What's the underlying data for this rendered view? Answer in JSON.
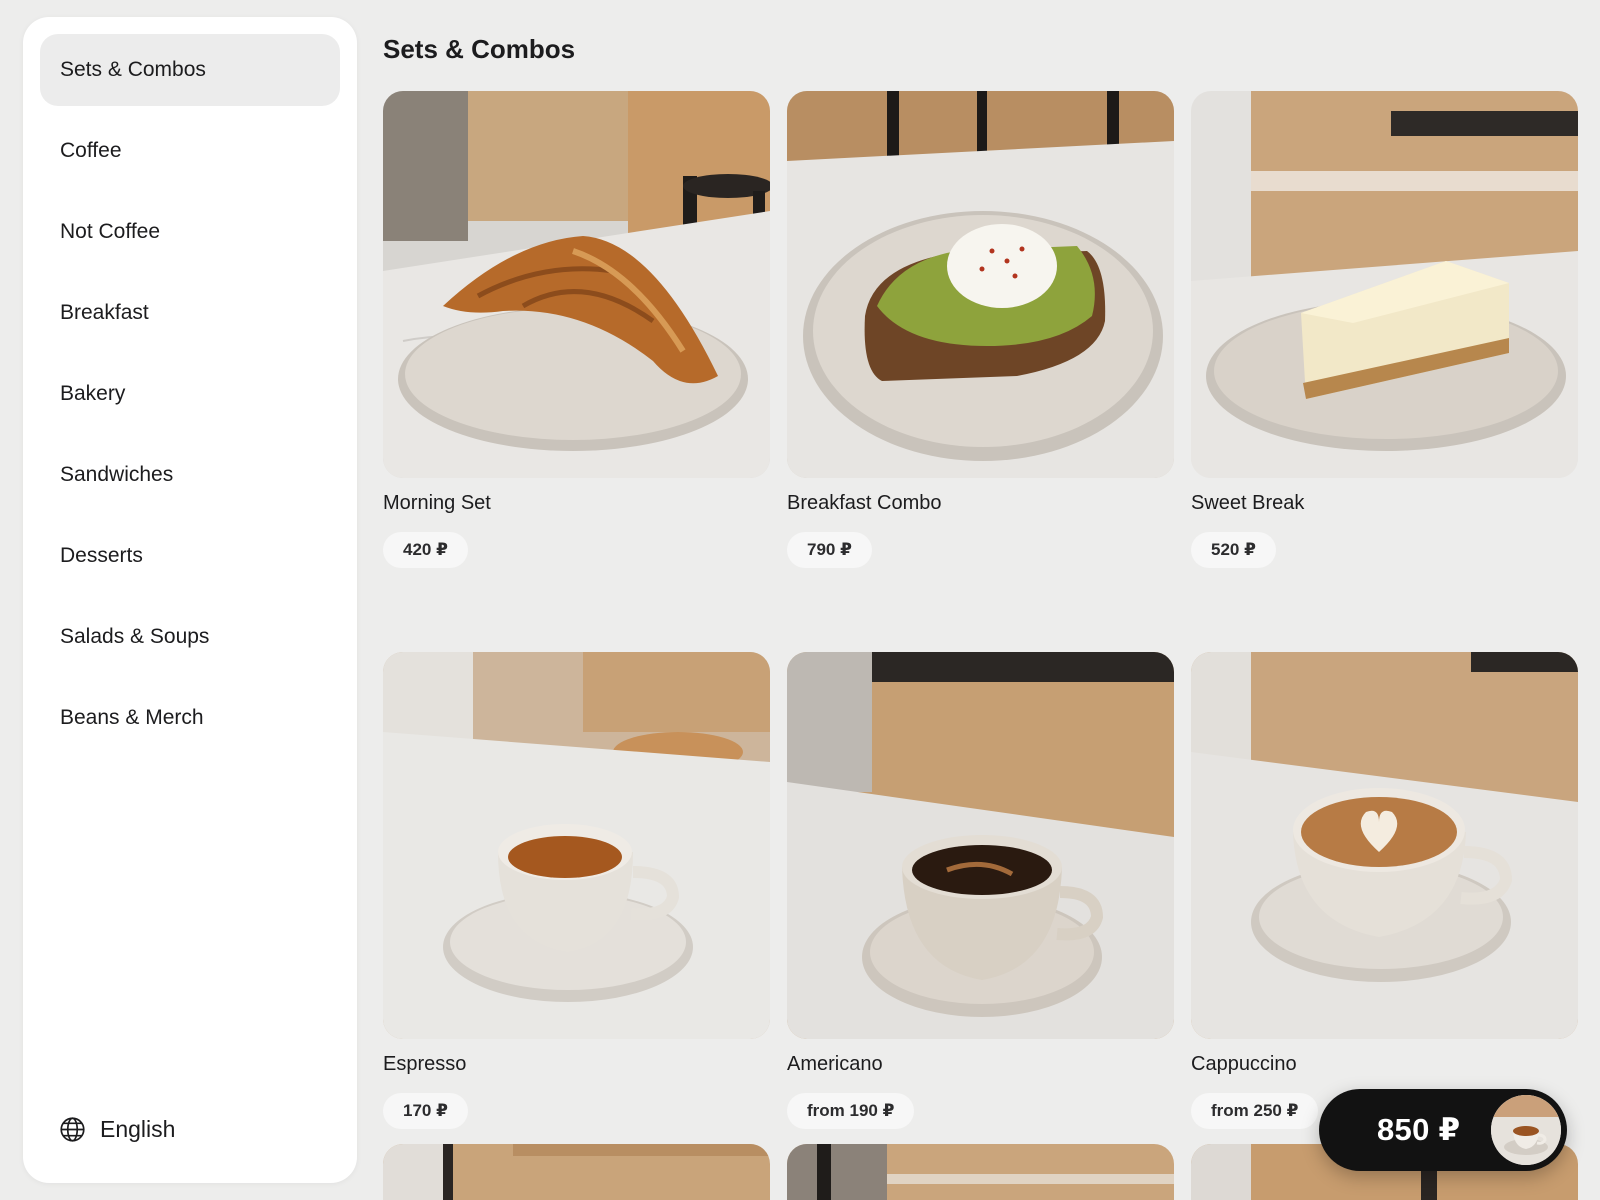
{
  "sidebar": {
    "categories": [
      {
        "label": "Sets & Combos",
        "active": true
      },
      {
        "label": "Coffee",
        "active": false
      },
      {
        "label": "Not Coffee",
        "active": false
      },
      {
        "label": "Breakfast",
        "active": false
      },
      {
        "label": "Bakery",
        "active": false
      },
      {
        "label": "Sandwiches",
        "active": false
      },
      {
        "label": "Desserts",
        "active": false
      },
      {
        "label": "Salads & Soups",
        "active": false
      },
      {
        "label": "Beans & Merch",
        "active": false
      }
    ],
    "language": {
      "label": "English",
      "icon": "globe-icon"
    }
  },
  "main": {
    "title": "Sets & Combos",
    "products": [
      {
        "name": "Morning Set",
        "price": "420 ₽",
        "image": "croissant-photo"
      },
      {
        "name": "Breakfast Combo",
        "price": "790 ₽",
        "image": "avocado-toast-photo"
      },
      {
        "name": "Sweet Break",
        "price": "520 ₽",
        "image": "cheesecake-photo"
      },
      {
        "name": "Espresso",
        "price": "170 ₽",
        "image": "espresso-photo"
      },
      {
        "name": "Americano",
        "price": "from 190 ₽",
        "image": "americano-photo"
      },
      {
        "name": "Cappuccino",
        "price": "from 250 ₽",
        "image": "cappuccino-photo"
      }
    ]
  },
  "cart": {
    "total": "850 ₽",
    "thumbnail": "cart-item-thumbnail"
  },
  "colors": {
    "background": "#ededec",
    "sidebar": "#ffffff",
    "active_item": "#ececec",
    "cart": "#121212"
  }
}
